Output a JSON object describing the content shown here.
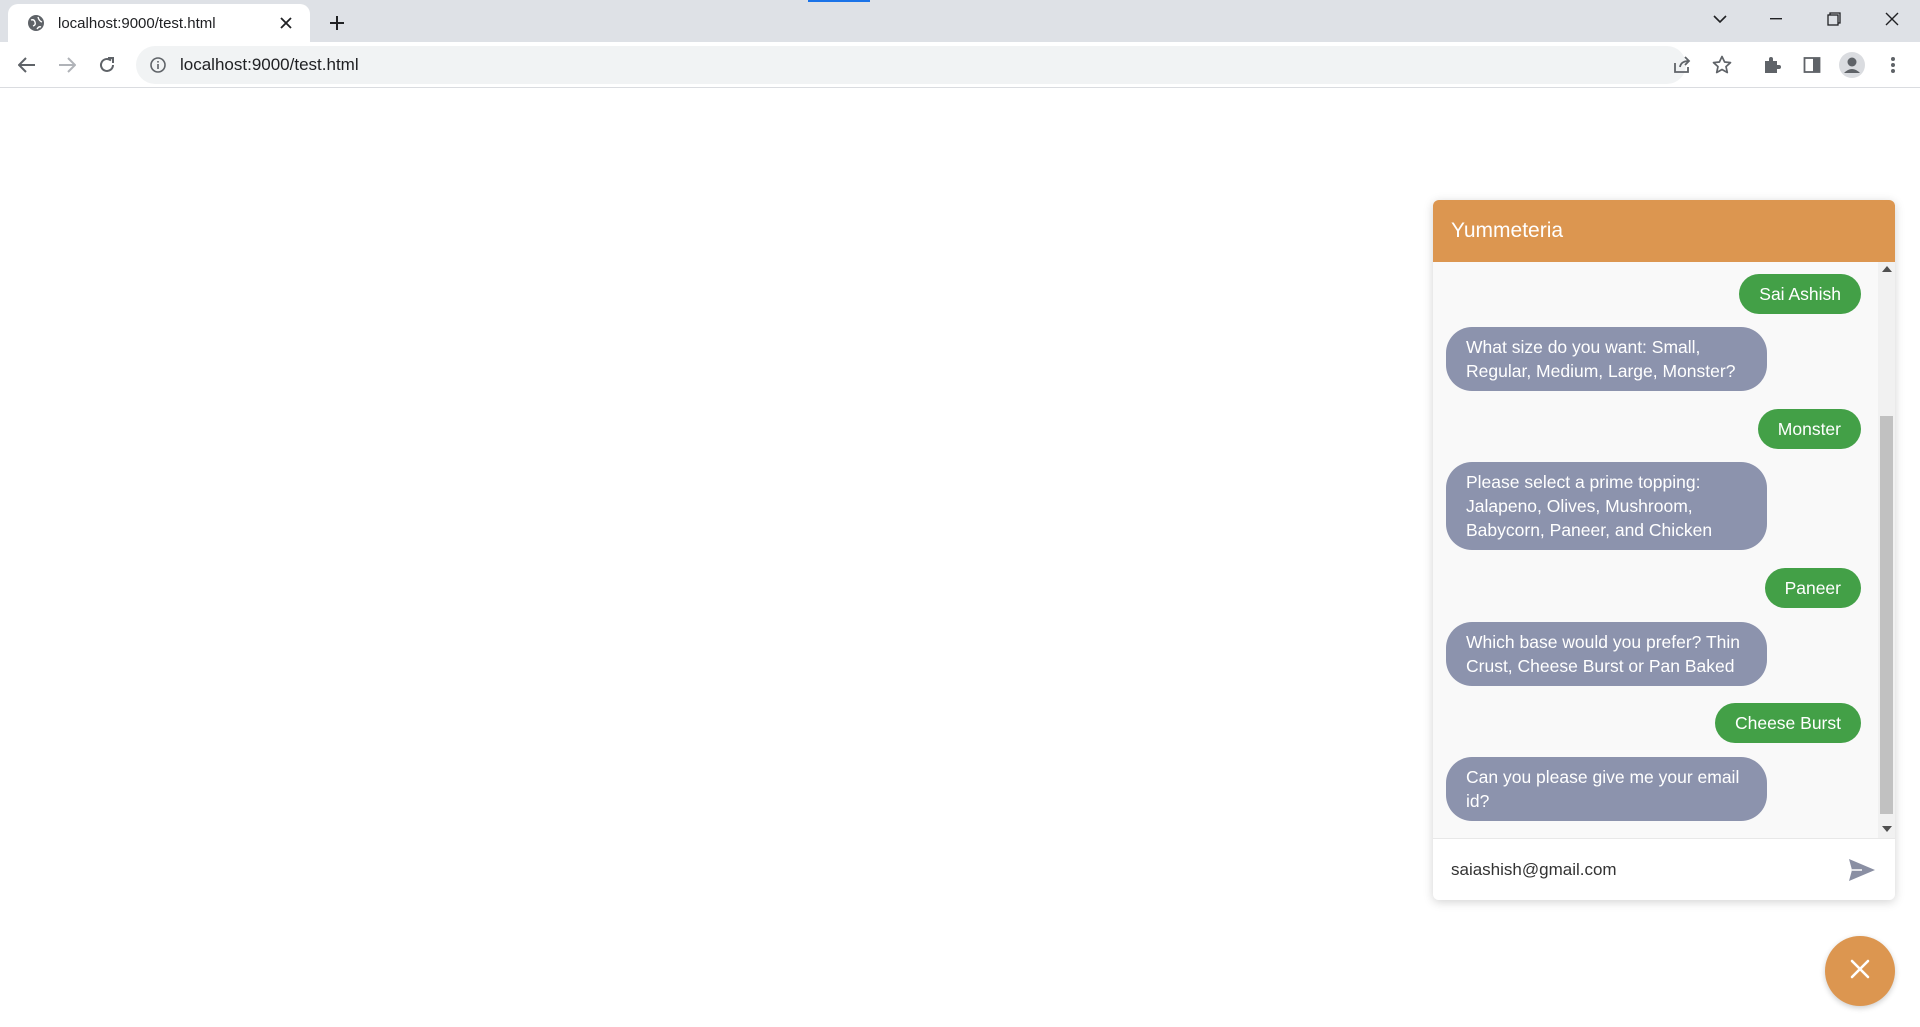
{
  "browser": {
    "tab_title": "localhost:9000/test.html",
    "url": "localhost:9000/test.html"
  },
  "chat": {
    "title": "Yummeteria",
    "messages": [
      {
        "from": "user",
        "text": "Sai Ashish"
      },
      {
        "from": "bot",
        "text": "What size do you want: Small, Regular, Medium, Large, Monster?"
      },
      {
        "from": "user",
        "text": "Monster"
      },
      {
        "from": "bot",
        "text": "Please select a prime topping: Jalapeno, Olives, Mushroom, Babycorn, Paneer, and Chicken"
      },
      {
        "from": "user",
        "text": "Paneer"
      },
      {
        "from": "bot",
        "text": "Which base would you prefer? Thin Crust, Cheese Burst or Pan Baked"
      },
      {
        "from": "user",
        "text": "Cheese Burst"
      },
      {
        "from": "bot",
        "text": "Can you please give me your email id?"
      }
    ],
    "input_value": "saiashish@gmail.com"
  },
  "colors": {
    "header": "#dc9650",
    "user_bubble": "#43a047",
    "bot_bubble": "#8c93ad",
    "fab": "#dc9650"
  },
  "icons": {
    "send": "send-icon",
    "fab": "close-icon"
  }
}
